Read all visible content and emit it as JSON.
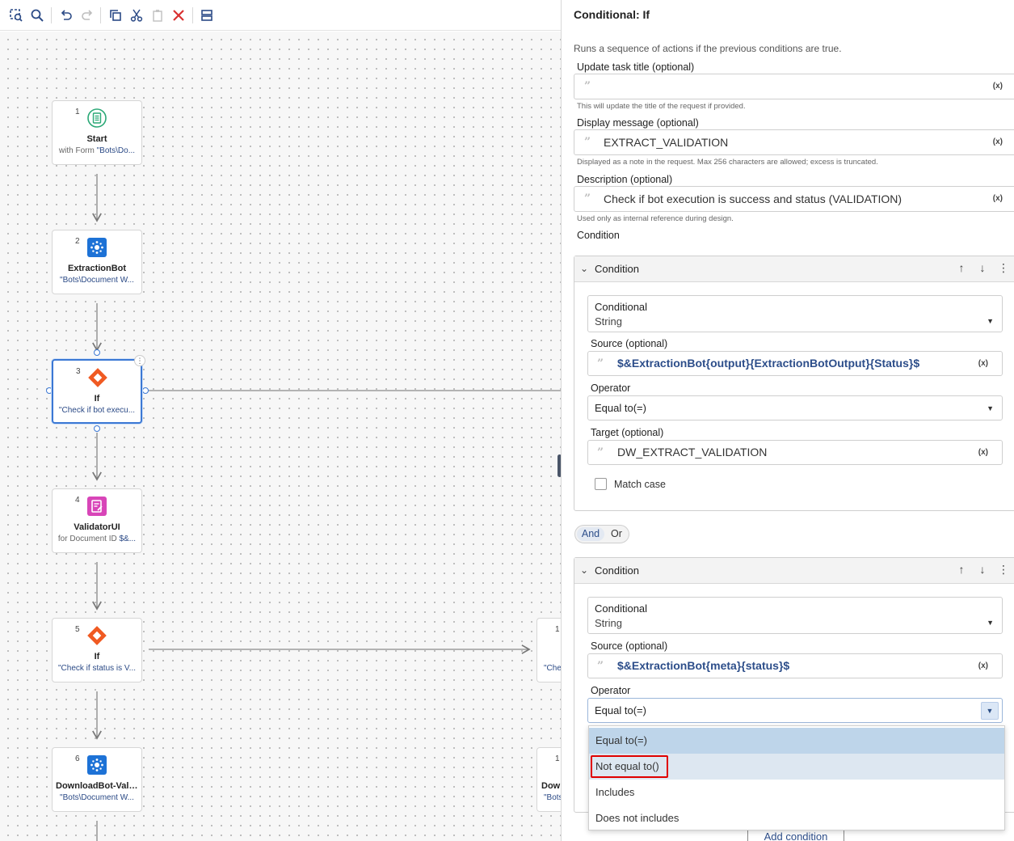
{
  "toolbar": {
    "icons": [
      "zoom-fit-icon",
      "search-icon",
      "undo-icon",
      "redo-icon",
      "copy-icon",
      "cut-icon",
      "paste-icon",
      "delete-icon",
      "layout-icon"
    ]
  },
  "flow": {
    "nodes": [
      {
        "num": "1",
        "title": "Start",
        "sub_prefix": "with Form ",
        "sub_value": "\"Bots\\Do...",
        "icon": "form-icon",
        "color": "#2aa876"
      },
      {
        "num": "2",
        "title": "ExtractionBot",
        "sub_prefix": "",
        "sub_value": "\"Bots\\Document W...",
        "icon": "bot-icon",
        "color": "#1d72d6"
      },
      {
        "num": "3",
        "title": "If",
        "sub_prefix": "",
        "sub_value": "\"Check if bot execu...",
        "icon": "conditional-icon",
        "color": "#f05a22"
      },
      {
        "num": "4",
        "title": "ValidatorUI",
        "sub_prefix": "for Document ID ",
        "sub_value": "$&...",
        "icon": "validator-icon",
        "color": "#d845b8"
      },
      {
        "num": "5",
        "title": "If",
        "sub_prefix": "",
        "sub_value": "\"Check if status is V...",
        "icon": "conditional-icon",
        "color": "#f05a22"
      },
      {
        "num": "6",
        "title": "DownloadBot-Vali...",
        "sub_prefix": "",
        "sub_value": "\"Bots\\Document W...",
        "icon": "bot-icon",
        "color": "#1d72d6"
      }
    ],
    "partial_nodes": [
      {
        "num": "1",
        "title": "",
        "sub_value": "\"Che"
      },
      {
        "num": "1",
        "title": "Dow",
        "sub_value": "\"Bots"
      }
    ]
  },
  "panel": {
    "title": "Conditional: If",
    "description": "Runs a sequence of actions if the previous conditions are true.",
    "task_title": {
      "label": "Update task title (optional)",
      "value": "",
      "hint": "This will update the title of the request if provided."
    },
    "display_message": {
      "label": "Display message (optional)",
      "value": "EXTRACT_VALIDATION",
      "hint": "Displayed as a note in the request. Max 256 characters are allowed; excess is truncated."
    },
    "description_field": {
      "label": "Description (optional)",
      "value": "Check if bot execution is success and status (VALIDATION)",
      "hint": "Used only as internal reference during design."
    },
    "var_symbol": "(x)",
    "quote_glyph": "”",
    "condition_label": "Condition",
    "conditions": [
      {
        "header": "Condition",
        "conditional_label": "Conditional",
        "conditional_value": "String",
        "source_label": "Source (optional)",
        "source_value": "$&ExtractionBot{output}{ExtractionBotOutput}{Status}$",
        "operator_label": "Operator",
        "operator_value": "Equal to(=)",
        "target_label": "Target (optional)",
        "target_value": "DW_EXTRACT_VALIDATION",
        "match_case": "Match case"
      },
      {
        "header": "Condition",
        "conditional_label": "Conditional",
        "conditional_value": "String",
        "source_label": "Source (optional)",
        "source_value": "$&ExtractionBot{meta}{status}$",
        "operator_label": "Operator",
        "operator_value": "Equal to(=)"
      }
    ],
    "logic": {
      "and": "And",
      "or": "Or"
    },
    "operator_options": [
      "Equal to(=)",
      "Not equal to()",
      "Includes",
      "Does not includes"
    ],
    "add_condition": "Add condition"
  }
}
